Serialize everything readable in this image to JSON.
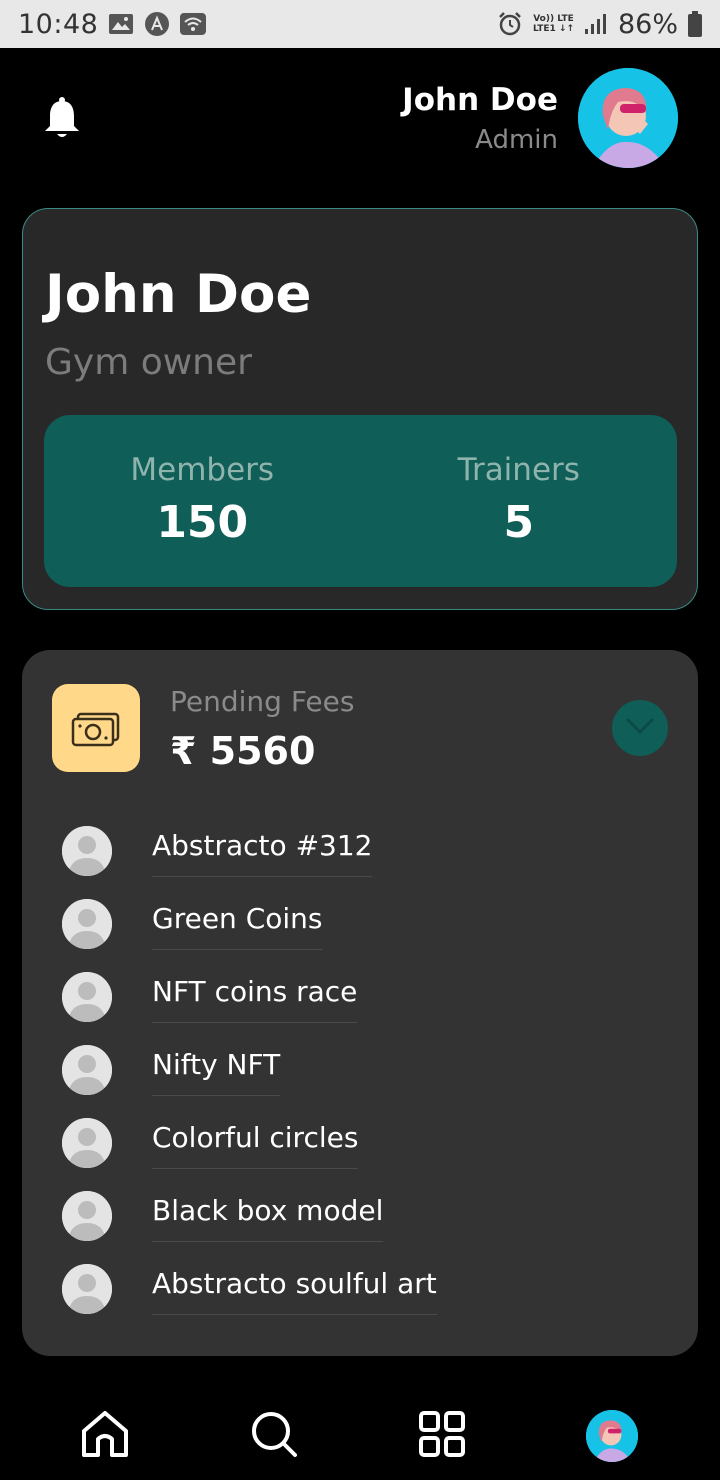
{
  "status_bar": {
    "time": "10:48",
    "network_top": "Vo)) LTE",
    "network_bottom": "LTE1 ↓↑",
    "battery": "86%"
  },
  "header": {
    "name": "John Doe",
    "role": "Admin"
  },
  "profile": {
    "name": "John Doe",
    "role": "Gym owner",
    "stats": [
      {
        "label": "Members",
        "value": "150"
      },
      {
        "label": "Trainers",
        "value": "5"
      }
    ]
  },
  "pending": {
    "label": "Pending Fees",
    "amount": "₹ 5560",
    "items": [
      {
        "name": "Abstracto #312"
      },
      {
        "name": "Green Coins"
      },
      {
        "name": "NFT coins race"
      },
      {
        "name": "Nifty NFT"
      },
      {
        "name": "Colorful circles"
      },
      {
        "name": "Black box model"
      },
      {
        "name": "Abstracto soulful art"
      }
    ]
  },
  "nav": {
    "items": [
      "home-icon",
      "search-icon",
      "grid-icon",
      "profile-avatar"
    ]
  },
  "colors": {
    "accent": "#0f5e57",
    "card_border": "#3a8a84",
    "money_icon_bg": "#ffd88a",
    "avatar_bg": "#16c3e6"
  }
}
